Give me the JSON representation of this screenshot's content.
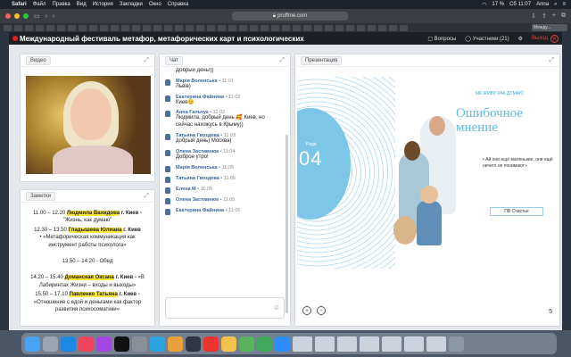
{
  "menubar": {
    "app": "Safari",
    "items": [
      "Файл",
      "Правка",
      "Вид",
      "История",
      "Закладки",
      "Окно",
      "Справка"
    ],
    "battery": "17 %",
    "clock": "Сб 11:07",
    "user": "Anna"
  },
  "browser": {
    "url": "pruffme.com",
    "active_tab": "Между..."
  },
  "app": {
    "title": "Международный фестиваль метафор, метафорических карт и психологических",
    "questions": "Вопросы",
    "participants": "Участники (21)",
    "exit": "Выход"
  },
  "video": {
    "label": "Видео"
  },
  "notes": {
    "label": "Заметки",
    "entries": [
      {
        "time": "11.00 – 12.20",
        "name": "Людмила Вахидова",
        "city": "г. Киев -",
        "text": "\"Жизнь, как думаю\""
      },
      {
        "time": "12.30 – 13.50",
        "name": "Гладышева Юлиана",
        "city": "г. Киев",
        "text": "• «Метафорическая коммуникация как инструмент работы психолога»"
      },
      {
        "plain": "13.50 – 14.20 - Обед"
      },
      {
        "time": "14.20 – 15.40",
        "name": "Доманская Оксана",
        "city": "г. Киев -",
        "text": "«В Лабиринтах Жизни – входы и выходы»"
      },
      {
        "time": "15.50 – 17.10",
        "name": "Павленко Татьяна",
        "city": "г. Киев -",
        "text": "«Отношение с едой и деньгами как фактор развития психосоматики»"
      }
    ]
  },
  "chat": {
    "label": "Чат",
    "messages": [
      {
        "author": "",
        "time": "",
        "text": "Добрый день!))"
      },
      {
        "author": "Марія Воленська",
        "time": "• 11:01",
        "text": "Львів)"
      },
      {
        "author": "Екатерина Файнина",
        "time": "• 11:02",
        "text": "Киев😊"
      },
      {
        "author": "Анна Гальчук",
        "time": "• 11:02",
        "text": "Людмила, добрый день 🥰 Киев, но сейчас нахожусь в Крыму))"
      },
      {
        "author": "Татьяна Гвоздева",
        "time": "• 11:03",
        "text": "добрый день) Москва)"
      },
      {
        "author": "Олена Заставнюк",
        "time": "• 11:04",
        "text": "Доброе утро!"
      },
      {
        "author": "Марія Воленська",
        "time": "• 11:05",
        "text": ""
      },
      {
        "author": "Татьяна Гвоздева",
        "time": "• 11:05",
        "text": ""
      },
      {
        "author": "Елена М",
        "time": "• 11:05",
        "text": ""
      },
      {
        "author": "Олена Заставнюк",
        "time": "• 11:05",
        "text": ""
      },
      {
        "author": "Екатерина Файнина",
        "time": "• 11:05",
        "text": ""
      }
    ]
  },
  "presentation": {
    "label": "Презентация",
    "page_label": "Page",
    "page_number": "04",
    "brand": "МК ЖИВУ КАК ДУМАЮ",
    "title": "Ошибочное мнение",
    "quote": "• Ай они ещё маленькие, они ещё ничего не понимают»",
    "tag": "ПВ Счастье",
    "current_page": "5"
  },
  "colors": {
    "accent": "#3a66a0",
    "highlight": "#fbe83a",
    "record": "#e02020",
    "slide_blue": "#7cc6e8"
  },
  "dock": {
    "icons": [
      "finder-icon",
      "launchpad-icon",
      "safari-icon",
      "music-icon",
      "podcasts-icon",
      "tv-icon",
      "settings-icon",
      "telegram-icon",
      "chrome-icon",
      "quicktime-icon",
      "yandex-icon",
      "photos-icon",
      "torrent-icon",
      "maps-icon",
      "zoom-icon",
      "trash-icon"
    ]
  }
}
